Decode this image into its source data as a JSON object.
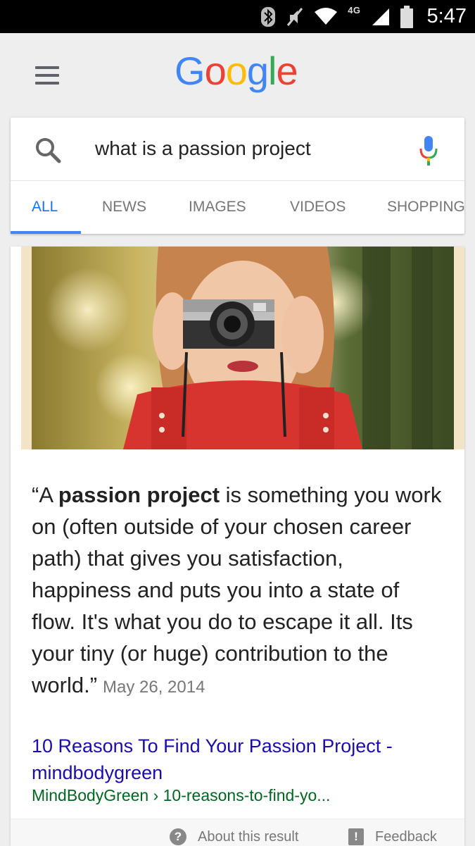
{
  "status_bar": {
    "network": "4G",
    "time": "5:47"
  },
  "header": {
    "logo_letters": [
      "G",
      "o",
      "o",
      "g",
      "l",
      "e"
    ]
  },
  "search": {
    "query": "what is a passion project"
  },
  "tabs": [
    {
      "label": "ALL",
      "active": true
    },
    {
      "label": "NEWS",
      "active": false
    },
    {
      "label": "IMAGES",
      "active": false
    },
    {
      "label": "VIDEOS",
      "active": false
    },
    {
      "label": "SHOPPING",
      "active": false
    }
  ],
  "result": {
    "image_alt": "woman taking a photo with a camera",
    "quote_open": "“A ",
    "quote_bold": "passion project",
    "quote_rest": " is something you work on (often outside of your chosen career path) that gives you satisfaction, happiness and puts you into a state of flow. It's what you do to escape it all. Its your tiny (or huge) contribution to the world.”",
    "date": "May 26, 2014",
    "link_title": "10 Reasons To Find Your Passion Project - mindbodygreen",
    "url": "MindBodyGreen › 10-reasons-to-find-yo...",
    "about_label": "About this result",
    "feedback_label": "Feedback"
  },
  "colors": {
    "google_blue": "#4285F4",
    "google_red": "#EA4335",
    "google_yellow": "#FBBC05",
    "google_green": "#34A853",
    "link": "#1a0dab",
    "url": "#006621"
  }
}
